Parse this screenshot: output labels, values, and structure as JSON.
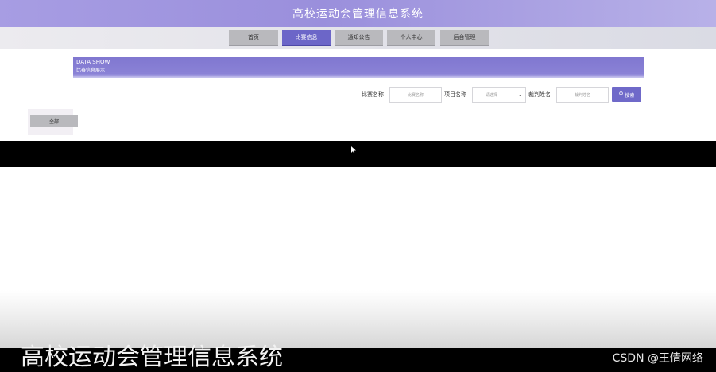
{
  "header": {
    "title": "高校运动会管理信息系统"
  },
  "nav": {
    "items": [
      {
        "label": "首页"
      },
      {
        "label": "比赛信息"
      },
      {
        "label": "通知公告"
      },
      {
        "label": "个人中心"
      },
      {
        "label": "后台管理"
      }
    ],
    "active_index": 1
  },
  "banner": {
    "title_en": "DATA SHOW",
    "title_cn": "比赛信息展示"
  },
  "search": {
    "name_label": "比赛名称",
    "name_placeholder": "比赛名称",
    "project_label": "项目名称",
    "project_value": "请选择",
    "referee_label": "裁判姓名",
    "referee_placeholder": "裁判姓名",
    "button_label": "搜索",
    "button_icon": "search-icon"
  },
  "category": {
    "label": "全部"
  },
  "footer": {
    "overlay_title": "高校运动会管理信息系统",
    "watermark": "CSDN @王倩网络"
  },
  "colors": {
    "accent": "#6f69c9",
    "header": "#9a8fdc",
    "active_nav": "#6c66c8"
  }
}
